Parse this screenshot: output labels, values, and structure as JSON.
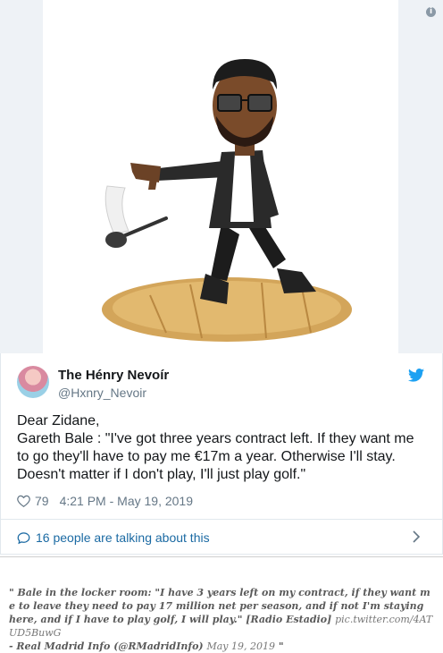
{
  "tweet": {
    "display_name": "The Hénry Nevoír",
    "handle": "@Hxnry_Nevoir",
    "text": "Dear Zidane,\nGareth Bale : \"I've got three years contract left. If they want me to go they'll have to pay me €17m a year. Otherwise I'll stay. Doesn't matter if I don't play, I'll just play golf.\"",
    "likes": "79",
    "timestamp": "4:21 PM - May 19, 2019",
    "talking_label": "16 people are talking about this",
    "info_label": "i"
  },
  "quote": {
    "text": "\" Bale in the locker room: \"I have 3 years left on my contract, if they want me to leave they need to pay 17 million net per season, and if not I'm staying here, and if I have to play golf, I will play.\" [Radio Estadio] ",
    "link": "pic.twitter.com/4ATUD5BuwG",
    "attribution": "- Real Madrid Info (@RMadridInfo) ",
    "date": "May 19, 2019",
    "end": " \""
  },
  "colors": {
    "twitter_blue": "#1da1f2",
    "link": "#1b6aa3",
    "muted": "#657786"
  },
  "icons": [
    "info-icon",
    "twitter-bird-icon",
    "heart-icon",
    "speech-bubble-icon",
    "chevron-right-icon"
  ]
}
